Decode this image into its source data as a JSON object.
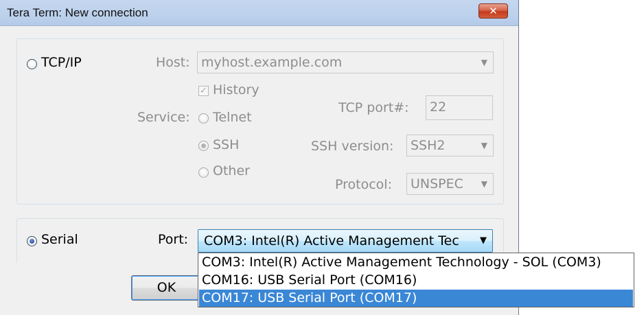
{
  "window": {
    "title": "Tera Term: New connection",
    "close_glyph": "✕"
  },
  "tcpip": {
    "radio_label": "TCP/IP",
    "host_label": "Host:",
    "host_value": "myhost.example.com",
    "history_label": "History",
    "history_checked": true,
    "service_label": "Service:",
    "telnet_label": "Telnet",
    "ssh_label": "SSH",
    "other_label": "Other",
    "service_selected": "SSH",
    "tcp_port_label": "TCP port#:",
    "tcp_port_value": "22",
    "ssh_version_label": "SSH version:",
    "ssh_version_value": "SSH2",
    "protocol_label": "Protocol:",
    "protocol_value": "UNSPEC"
  },
  "serial": {
    "radio_label": "Serial",
    "port_label": "Port:",
    "port_value": "COM3: Intel(R) Active Management Tec",
    "options": [
      "COM3: Intel(R) Active Management Technology - SOL (COM3)",
      "COM16: USB Serial Port (COM16)",
      "COM17: USB Serial Port (COM17)"
    ],
    "highlighted_index": 2
  },
  "buttons": {
    "ok_label": "OK"
  },
  "icons": {
    "dropdown_arrow": "▼",
    "check": "✓"
  },
  "colors": {
    "selection": "#3a87d6",
    "disabled_text": "#8d8d8d"
  }
}
